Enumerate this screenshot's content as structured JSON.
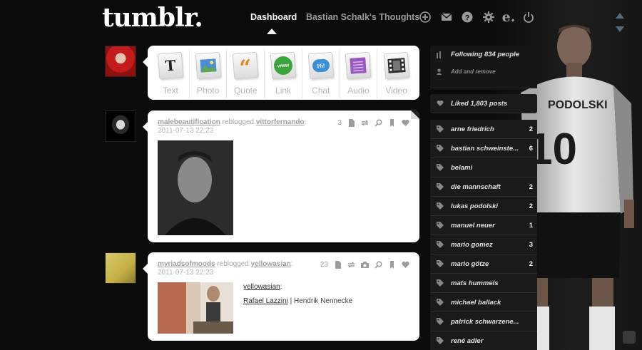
{
  "header": {
    "logo": "tumblr.",
    "nav": {
      "dashboard": "Dashboard",
      "blog": "Bastian Schalk's Thoughts"
    },
    "icons": [
      "plus-icon",
      "mail-icon",
      "help-icon",
      "gear-icon",
      "e-icon",
      "power-icon"
    ]
  },
  "composer": {
    "types": [
      {
        "label": "Text",
        "icon": "text-icon",
        "glyph": "T"
      },
      {
        "label": "Photo",
        "icon": "photo-icon"
      },
      {
        "label": "Quote",
        "icon": "quote-icon",
        "glyph": "“"
      },
      {
        "label": "Link",
        "icon": "link-icon",
        "glyph": "www"
      },
      {
        "label": "Chat",
        "icon": "chat-icon",
        "glyph": "Hi!"
      },
      {
        "label": "Audio",
        "icon": "audio-icon"
      },
      {
        "label": "Video",
        "icon": "video-icon"
      }
    ]
  },
  "posts": [
    {
      "user": "malebeautification",
      "action": " reblogged ",
      "source": "vittorfernando",
      "colon": ":",
      "date": "2011-07-13 22:23",
      "notes": "3"
    },
    {
      "user": "myriadsofmoods",
      "action": " reblogged ",
      "source": "yellowasian",
      "colon": ":",
      "date": "2011-07-13 22:23",
      "notes": "23",
      "caption_user": "yellowasian",
      "caption_user_colon": ":",
      "caption_link": "Rafael Lazzini",
      "caption_rest": " | Hendrik Nennecke"
    }
  ],
  "sidebar": {
    "following": "Following 834 people",
    "add_remove": "Add and remove",
    "liked": "Liked 1,803 posts",
    "tags": [
      {
        "name": "arne friedrich",
        "count": "2"
      },
      {
        "name": "bastian schweinste...",
        "count": "6"
      },
      {
        "name": "belami",
        "count": ""
      },
      {
        "name": "die mannschaft",
        "count": "2"
      },
      {
        "name": "lukas podolski",
        "count": "2"
      },
      {
        "name": "manuel neuer",
        "count": "1"
      },
      {
        "name": "mario gomez",
        "count": "3"
      },
      {
        "name": "mario götze",
        "count": "2"
      },
      {
        "name": "mats hummels",
        "count": ""
      },
      {
        "name": "michael ballack",
        "count": ""
      },
      {
        "name": "patrick schwarzene...",
        "count": ""
      },
      {
        "name": "rené adler",
        "count": ""
      }
    ]
  },
  "background": {
    "jersey_text": "PODOLSKI",
    "number": "10"
  }
}
